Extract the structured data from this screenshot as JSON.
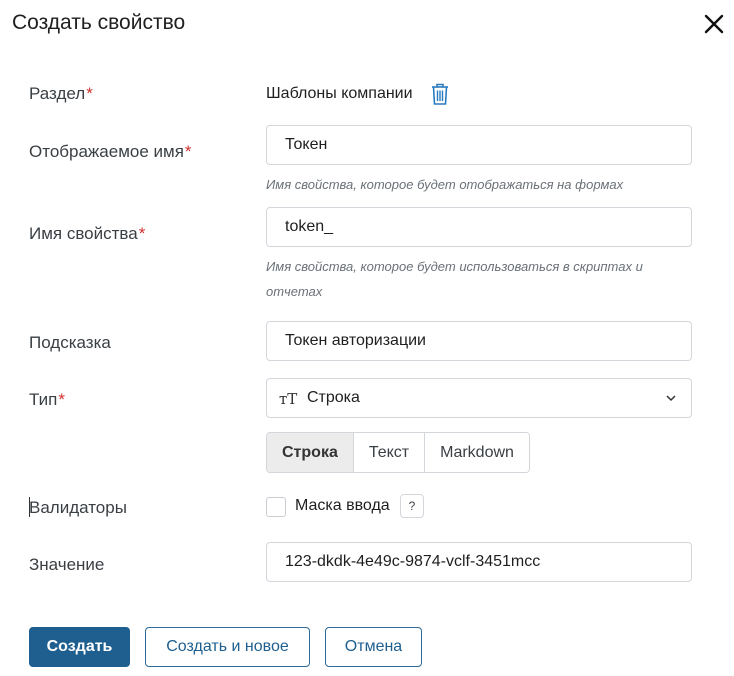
{
  "dialog": {
    "title": "Создать свойство",
    "close_icon": "close-icon"
  },
  "form": {
    "section": {
      "label": "Раздел",
      "required_mark": "*",
      "value": "Шаблоны компании",
      "icon": "trash-icon"
    },
    "display_name": {
      "label": "Отображаемое имя",
      "required_mark": "*",
      "value": "Токен",
      "hint": "Имя свойства, которое будет отображаться на формах"
    },
    "property_name": {
      "label": "Имя свойства",
      "required_mark": "*",
      "value": "token_",
      "hint": "Имя свойства, которое будет использоваться в скриптах и отчетах"
    },
    "tooltip": {
      "label": "Подсказка",
      "value": "Токен авторизации"
    },
    "type": {
      "label": "Тип",
      "required_mark": "*",
      "icon_glyph": "тТ",
      "value": "Строка",
      "dropdown_icon": "chevron-down-icon",
      "modes": [
        "Строка",
        "Текст",
        "Markdown"
      ],
      "active_mode": "Строка"
    },
    "validators": {
      "label": "Валидаторы",
      "checkbox_label": "Маска ввода",
      "checked": false,
      "help_glyph": "?"
    },
    "value": {
      "label": "Значение",
      "value": "123-dkdk-4e49c-9874-vclf-3451mcc"
    }
  },
  "buttons": {
    "create": "Создать",
    "create_and_new": "Создать и новое",
    "cancel": "Отмена"
  },
  "colors": {
    "primary": "#1e5f8f",
    "required": "#d0312d",
    "icon_blue": "#2b6a99"
  }
}
